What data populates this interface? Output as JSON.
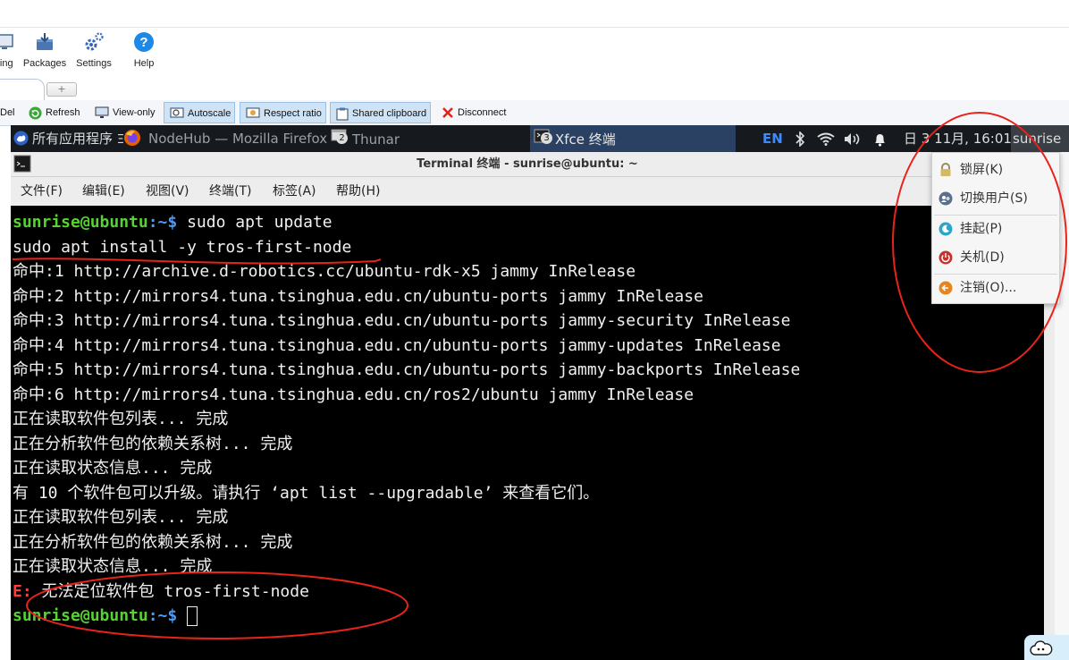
{
  "viewer": {
    "ribbon": [
      {
        "label": "ling",
        "icon": "monitor-icon"
      },
      {
        "label": "Packages",
        "icon": "packages-icon"
      },
      {
        "label": "Settings",
        "icon": "settings-icon"
      },
      {
        "label": "Help",
        "icon": "help-icon"
      }
    ],
    "new_tab_glyph": "+",
    "actions": {
      "del": "Del",
      "refresh": "Refresh",
      "view_only": "View-only",
      "autoscale": "Autoscale",
      "respect_ratio": "Respect ratio",
      "shared_clipboard": "Shared clipboard",
      "disconnect": "Disconnect"
    }
  },
  "panel": {
    "apps_menu": "所有应用程序",
    "apps_menu_suffix": "Ξ",
    "tasks": [
      {
        "label": "NodeHub — Mozilla Firefox",
        "badge": ""
      },
      {
        "label": "Thunar",
        "badge": "2"
      },
      {
        "label": "Xfce 终端",
        "badge": "3",
        "active": true
      }
    ],
    "keyboard_layout": "EN",
    "date_time": "日 3 11月, 16:01",
    "user": "sunrise"
  },
  "terminal": {
    "title": "Terminal 终端 - sunrise@ubuntu: ~",
    "menu": [
      "文件(F)",
      "编辑(E)",
      "视图(V)",
      "终端(T)",
      "标签(A)",
      "帮助(H)"
    ],
    "prompt_user": "sunrise@ubuntu",
    "prompt_path": ":~$",
    "command_1": " sudo apt update",
    "command_2": "sudo apt install -y tros-first-node",
    "output": [
      "命中:1 http://archive.d-robotics.cc/ubuntu-rdk-x5 jammy InRelease",
      "命中:2 http://mirrors4.tuna.tsinghua.edu.cn/ubuntu-ports jammy InRelease",
      "命中:3 http://mirrors4.tuna.tsinghua.edu.cn/ubuntu-ports jammy-security InRelease",
      "命中:4 http://mirrors4.tuna.tsinghua.edu.cn/ubuntu-ports jammy-updates InRelease",
      "命中:5 http://mirrors4.tuna.tsinghua.edu.cn/ubuntu-ports jammy-backports InRelease",
      "命中:6 http://mirrors4.tuna.tsinghua.edu.cn/ros2/ubuntu jammy InRelease",
      "正在读取软件包列表... 完成",
      "正在分析软件包的依赖关系树... 完成",
      "正在读取状态信息... 完成",
      "有 10 个软件包可以升级。请执行 ‘apt list --upgradable’ 来查看它们。",
      "正在读取软件包列表... 完成",
      "正在分析软件包的依赖关系树... 完成",
      "正在读取状态信息... 完成"
    ],
    "error_prefix": "E:",
    "error_message": " 无法定位软件包 tros-first-node"
  },
  "session_menu": {
    "items": [
      {
        "label": "锁屏(K)",
        "icon": "lock-icon"
      },
      {
        "label": "切换用户(S)",
        "icon": "switch-user-icon"
      },
      {
        "label": "挂起(P)",
        "icon": "suspend-icon"
      },
      {
        "label": "关机(D)",
        "icon": "power-icon"
      },
      {
        "label": "注销(O)...",
        "icon": "logout-icon"
      }
    ]
  },
  "colors": {
    "annotation": "#e8231c",
    "prompt_user": "#56d232",
    "prompt_path": "#4d9bf0",
    "error": "#ff3b3b",
    "panel_bg": "#161a1f",
    "active_task": "#2b4163"
  }
}
